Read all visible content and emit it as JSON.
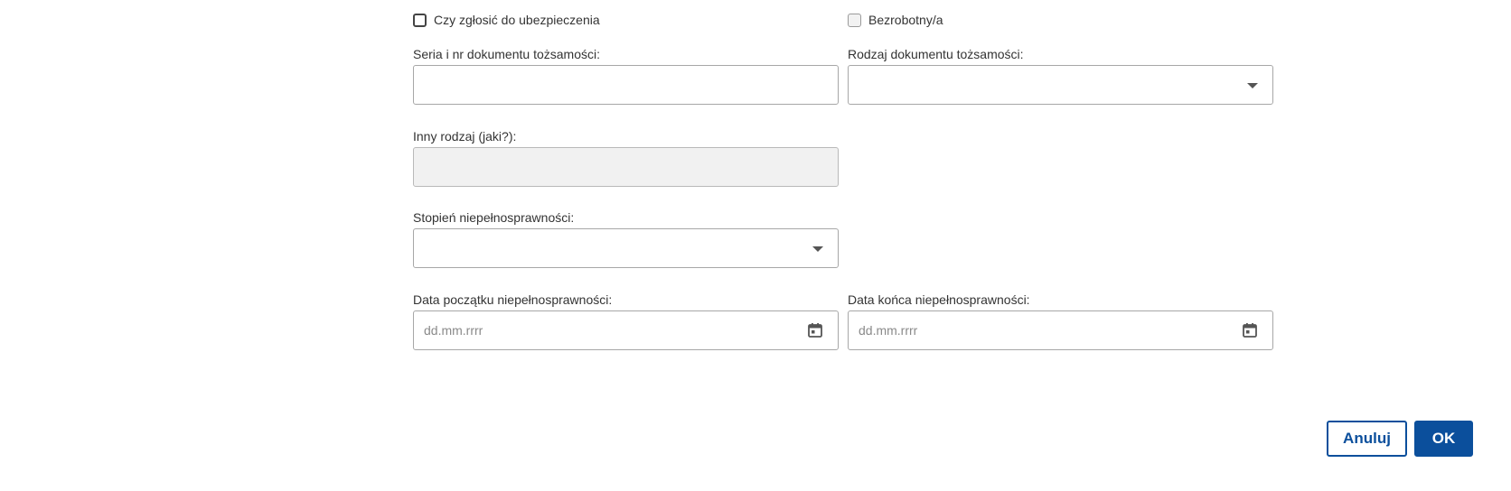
{
  "checkboxes": {
    "insurance": {
      "label": "Czy zgłosić do ubezpieczenia",
      "checked": false
    },
    "unemployed": {
      "label": "Bezrobotny/a",
      "checked": false,
      "disabled": true
    }
  },
  "fields": {
    "id_number": {
      "label": "Seria i nr dokumentu tożsamości:",
      "value": ""
    },
    "id_type": {
      "label": "Rodzaj dokumentu tożsamości:",
      "value": "",
      "icon": "chevron-down-icon"
    },
    "other_type": {
      "label": "Inny rodzaj (jaki?):",
      "value": "",
      "disabled": true
    },
    "disability_degree": {
      "label": "Stopień niepełnosprawności:",
      "value": "",
      "icon": "chevron-down-icon"
    },
    "disability_start": {
      "label": "Data początku niepełnosprawności:",
      "value": "",
      "placeholder": "dd.mm.rrrr",
      "icon": "calendar-icon"
    },
    "disability_end": {
      "label": "Data końca niepełnosprawności:",
      "value": "",
      "placeholder": "dd.mm.rrrr",
      "icon": "calendar-icon"
    }
  },
  "actions": {
    "cancel_label": "Anuluj",
    "ok_label": "OK"
  },
  "colors": {
    "primary": "#0b4f9c",
    "border": "#a7a7a7",
    "disabled_bg": "#f1f1f1"
  }
}
